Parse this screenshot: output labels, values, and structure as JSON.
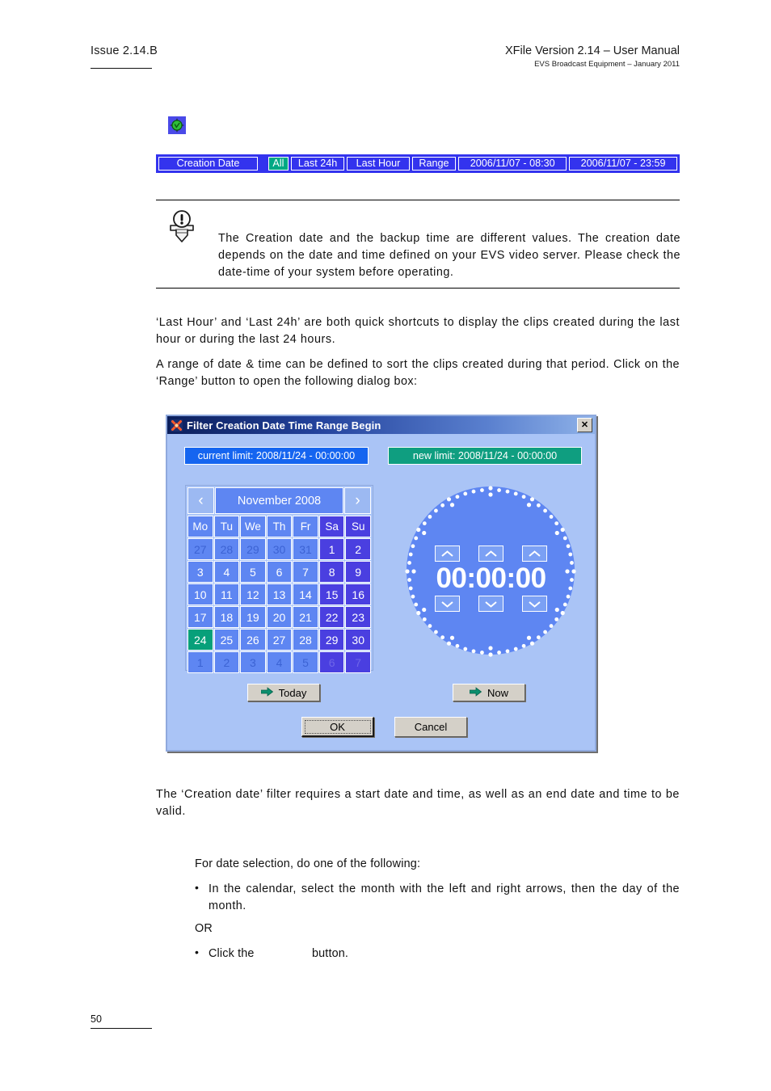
{
  "header": {
    "issue": "Issue 2.14.B",
    "manual_title": "XFile Version 2.14 – User Manual",
    "manual_sub": "EVS Broadcast Equipment – January 2011"
  },
  "app_icon": {
    "name": "green-gem-icon"
  },
  "filter_bar": {
    "label": "Creation Date",
    "buttons": [
      {
        "label": "All",
        "active": true
      },
      {
        "label": "Last 24h",
        "active": false
      },
      {
        "label": "Last Hour",
        "active": false
      },
      {
        "label": "Range",
        "active": false
      }
    ],
    "start_value": "2006/11/07 - 08:30",
    "end_value": "2006/11/07 - 23:59",
    "bar_color": "#3333ee",
    "active_color": "#00a884"
  },
  "note": {
    "icon": "warning-note-icon",
    "text": "The Creation date and the backup time are different values. The creation date depends on the date and time defined on your EVS video server. Please check the date-time of your system before operating."
  },
  "paragraphs": {
    "p1": "‘Last Hour’ and ‘Last 24h’ are both quick shortcuts to display the clips created during the last hour or during the last 24 hours.",
    "p2": "A range of date & time can be defined to sort the clips created during that period. Click on the ‘Range’ button to open the following dialog box:",
    "p3": "The ‘Creation date’ filter requires a start date and time, as well as an end date and time to be valid.",
    "p4": "For date selection, do one of the following:",
    "or": "OR"
  },
  "bullets": {
    "b1": "In the calendar, select the month with the left and right arrows, then the day of the month.",
    "b2_before": "Click the",
    "b2_after": "button.",
    "dot": "•"
  },
  "dialog": {
    "title": "Filter Creation Date Time Range Begin",
    "title_icon": "app-x-icon",
    "close_label": "✕",
    "current_limit": "current limit: 2008/11/24 - 00:00:00",
    "new_limit": "new limit: 2008/11/24 - 00:00:00",
    "current_limit_color": "#1565f0",
    "new_limit_color": "#0f9e80",
    "calendar": {
      "prev_arrow": "‹",
      "next_arrow": "›",
      "month_label": "November 2008",
      "weekdays": [
        "Mo",
        "Tu",
        "We",
        "Th",
        "Fr",
        "Sa",
        "Su"
      ],
      "weeks": [
        [
          {
            "d": "27",
            "other": true,
            "weekend": false
          },
          {
            "d": "28",
            "other": true,
            "weekend": false
          },
          {
            "d": "29",
            "other": true,
            "weekend": false
          },
          {
            "d": "30",
            "other": true,
            "weekend": false
          },
          {
            "d": "31",
            "other": true,
            "weekend": false
          },
          {
            "d": "1",
            "other": false,
            "weekend": true
          },
          {
            "d": "2",
            "other": false,
            "weekend": true
          }
        ],
        [
          {
            "d": "3",
            "other": false,
            "weekend": false
          },
          {
            "d": "4",
            "other": false,
            "weekend": false
          },
          {
            "d": "5",
            "other": false,
            "weekend": false
          },
          {
            "d": "6",
            "other": false,
            "weekend": false
          },
          {
            "d": "7",
            "other": false,
            "weekend": false
          },
          {
            "d": "8",
            "other": false,
            "weekend": true
          },
          {
            "d": "9",
            "other": false,
            "weekend": true
          }
        ],
        [
          {
            "d": "10",
            "other": false,
            "weekend": false
          },
          {
            "d": "11",
            "other": false,
            "weekend": false
          },
          {
            "d": "12",
            "other": false,
            "weekend": false
          },
          {
            "d": "13",
            "other": false,
            "weekend": false
          },
          {
            "d": "14",
            "other": false,
            "weekend": false
          },
          {
            "d": "15",
            "other": false,
            "weekend": true
          },
          {
            "d": "16",
            "other": false,
            "weekend": true
          }
        ],
        [
          {
            "d": "17",
            "other": false,
            "weekend": false
          },
          {
            "d": "18",
            "other": false,
            "weekend": false
          },
          {
            "d": "19",
            "other": false,
            "weekend": false
          },
          {
            "d": "20",
            "other": false,
            "weekend": false
          },
          {
            "d": "21",
            "other": false,
            "weekend": false
          },
          {
            "d": "22",
            "other": false,
            "weekend": true
          },
          {
            "d": "23",
            "other": false,
            "weekend": true
          }
        ],
        [
          {
            "d": "24",
            "other": false,
            "weekend": false,
            "selected": true
          },
          {
            "d": "25",
            "other": false,
            "weekend": false
          },
          {
            "d": "26",
            "other": false,
            "weekend": false
          },
          {
            "d": "27",
            "other": false,
            "weekend": false
          },
          {
            "d": "28",
            "other": false,
            "weekend": false
          },
          {
            "d": "29",
            "other": false,
            "weekend": true
          },
          {
            "d": "30",
            "other": false,
            "weekend": true
          }
        ],
        [
          {
            "d": "1",
            "other": true,
            "weekend": false
          },
          {
            "d": "2",
            "other": true,
            "weekend": false
          },
          {
            "d": "3",
            "other": true,
            "weekend": false
          },
          {
            "d": "4",
            "other": true,
            "weekend": false
          },
          {
            "d": "5",
            "other": true,
            "weekend": false
          },
          {
            "d": "6",
            "other": true,
            "weekend": true
          },
          {
            "d": "7",
            "other": true,
            "weekend": true
          }
        ]
      ],
      "selected_day": "24",
      "selected_color": "#07a07a"
    },
    "clock": {
      "time": "00:00:00",
      "tick_count": 60,
      "face_color": "#5e86f2",
      "up_arrow": "up-arrow-icon",
      "down_arrow": "down-arrow-icon"
    },
    "buttons": {
      "today": "Today",
      "now": "Now",
      "ok": "OK",
      "cancel": "Cancel",
      "arrow_color": "#0b8f6e"
    }
  },
  "footer": {
    "page_number": "50"
  }
}
